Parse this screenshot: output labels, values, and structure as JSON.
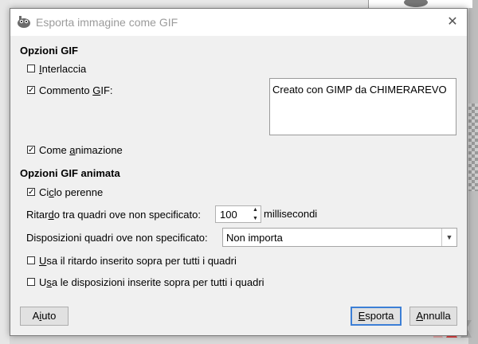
{
  "window": {
    "title": "Esporta immagine come GIF",
    "close_symbol": "✕",
    "app_icon": "gimp-icon"
  },
  "gif_options": {
    "heading": "Opzioni GIF",
    "interlace": {
      "label_pre": "",
      "label_u": "I",
      "label_post": "nterlaccia",
      "checked": false
    },
    "comment": {
      "label_pre": "Commento ",
      "label_u": "G",
      "label_post": "IF:",
      "checked": true,
      "value": "Creato con GIMP da CHIMERAREVO"
    },
    "as_animation": {
      "label_pre": "Come ",
      "label_u": "a",
      "label_post": "nimazione",
      "checked": true
    }
  },
  "animated_options": {
    "heading": "Opzioni GIF animata",
    "loop_forever": {
      "label_pre": "Ci",
      "label_u": "c",
      "label_post": "lo perenne",
      "checked": true
    },
    "delay": {
      "label_pre": "Ritar",
      "label_u": "d",
      "label_post": "o tra quadri ove non specificato:",
      "value": "100",
      "unit": "millisecondi"
    },
    "disposal": {
      "label": "Disposizioni quadri ove non specificato:",
      "value": "Non importa"
    },
    "use_delay_all": {
      "label_pre": "",
      "label_u": "U",
      "label_post": "sa il ritardo inserito sopra per tutti i quadri",
      "checked": false
    },
    "use_disposal_all": {
      "label_pre": "U",
      "label_u": "s",
      "label_post": "a le disposizioni inserite sopra per tutti i quadri",
      "checked": false
    }
  },
  "buttons": {
    "help": {
      "pre": "A",
      "u": "i",
      "post": "uto"
    },
    "export": {
      "pre": "",
      "u": "E",
      "post": "sporta"
    },
    "cancel": {
      "pre": "",
      "u": "A",
      "post": "nnulla"
    }
  },
  "colors": {
    "accent": "#3c7fd6",
    "dialog_bg": "#f0f0f0"
  }
}
